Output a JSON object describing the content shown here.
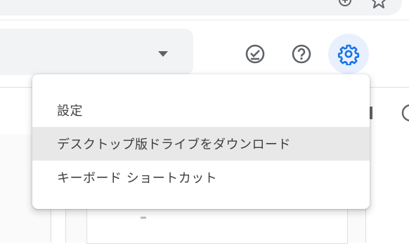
{
  "browser": {
    "icons": [
      "zoom-in-icon",
      "star-icon"
    ]
  },
  "toolbar": {
    "icons": [
      "offline-check-icon",
      "help-icon",
      "settings-gear-icon"
    ],
    "accent_color": "#1a73e8"
  },
  "settings_menu": {
    "items": [
      {
        "label": "設定"
      },
      {
        "label": "デスクトップ版ドライブをダウンロード"
      },
      {
        "label": "キーボード ショートカット"
      }
    ]
  }
}
